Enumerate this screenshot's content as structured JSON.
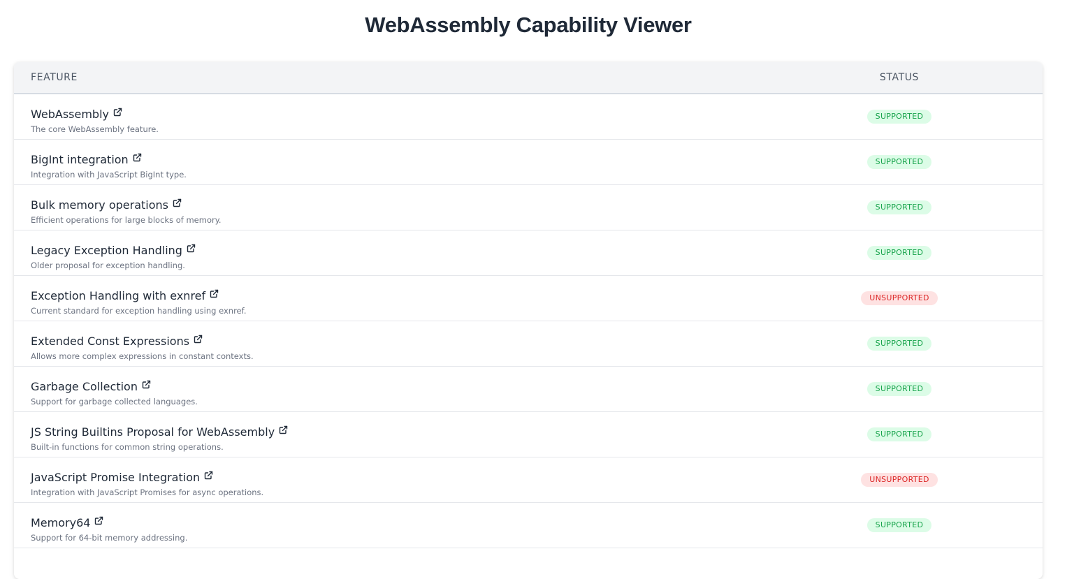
{
  "title": "WebAssembly Capability Viewer",
  "columns": {
    "feature": "FEATURE",
    "status": "STATUS"
  },
  "colors": {
    "supported_bg": "#dcfce7",
    "supported_fg": "#16a34a",
    "unsupported_bg": "#fee2e2",
    "unsupported_fg": "#dc2626"
  },
  "features": [
    {
      "name": "WebAssembly",
      "description": "The core WebAssembly feature.",
      "status": "SUPPORTED",
      "supported": true,
      "icon": "external-link-icon"
    },
    {
      "name": "BigInt integration",
      "description": "Integration with JavaScript BigInt type.",
      "status": "SUPPORTED",
      "supported": true,
      "icon": "external-link-icon"
    },
    {
      "name": "Bulk memory operations",
      "description": "Efficient operations for large blocks of memory.",
      "status": "SUPPORTED",
      "supported": true,
      "icon": "external-link-icon"
    },
    {
      "name": "Legacy Exception Handling",
      "description": "Older proposal for exception handling.",
      "status": "SUPPORTED",
      "supported": true,
      "icon": "external-link-icon"
    },
    {
      "name": "Exception Handling with exnref",
      "description": "Current standard for exception handling using exnref.",
      "status": "UNSUPPORTED",
      "supported": false,
      "icon": "external-link-icon"
    },
    {
      "name": "Extended Const Expressions",
      "description": "Allows more complex expressions in constant contexts.",
      "status": "SUPPORTED",
      "supported": true,
      "icon": "external-link-icon"
    },
    {
      "name": "Garbage Collection",
      "description": "Support for garbage collected languages.",
      "status": "SUPPORTED",
      "supported": true,
      "icon": "external-link-icon"
    },
    {
      "name": "JS String Builtins Proposal for WebAssembly",
      "description": "Built-in functions for common string operations.",
      "status": "SUPPORTED",
      "supported": true,
      "icon": "external-link-icon"
    },
    {
      "name": "JavaScript Promise Integration",
      "description": "Integration with JavaScript Promises for async operations.",
      "status": "UNSUPPORTED",
      "supported": false,
      "icon": "external-link-icon"
    },
    {
      "name": "Memory64",
      "description": "Support for 64-bit memory addressing.",
      "status": "SUPPORTED",
      "supported": true,
      "icon": "external-link-icon"
    }
  ]
}
